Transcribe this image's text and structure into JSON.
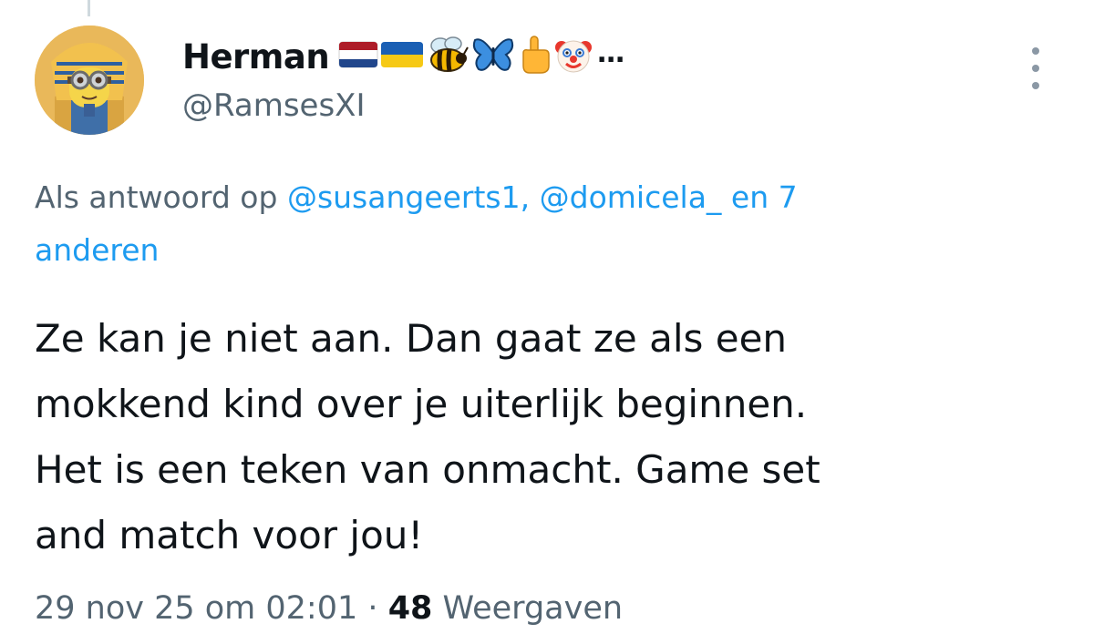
{
  "tweet": {
    "author": {
      "display_name": "Herman",
      "handle": "@RamsesXI",
      "name_suffix": "…",
      "name_emojis": [
        "flag-netherlands-icon",
        "flag-ukraine-icon",
        "bee-icon",
        "butterfly-icon",
        "middle-finger-icon",
        "clown-face-icon"
      ]
    },
    "reply_to": {
      "prefix": "Als antwoord op",
      "mentions": [
        "@susangeerts1,",
        "@domicela_"
      ],
      "suffix_line1": "en 7",
      "suffix_line2": "anderen"
    },
    "text_lines": [
      "Ze kan je niet aan. Dan gaat ze als een",
      "mokkend kind over je uiterlijk beginnen.",
      "Het is een teken van onmacht. Game set",
      "and match voor jou!"
    ],
    "timestamp": "29 nov 25 om 02:01",
    "separator": "·",
    "views_count": "48",
    "views_label": "Weergaven"
  },
  "colors": {
    "text_primary": "#0f1419",
    "text_secondary": "#536471",
    "link": "#1d9bf0"
  }
}
